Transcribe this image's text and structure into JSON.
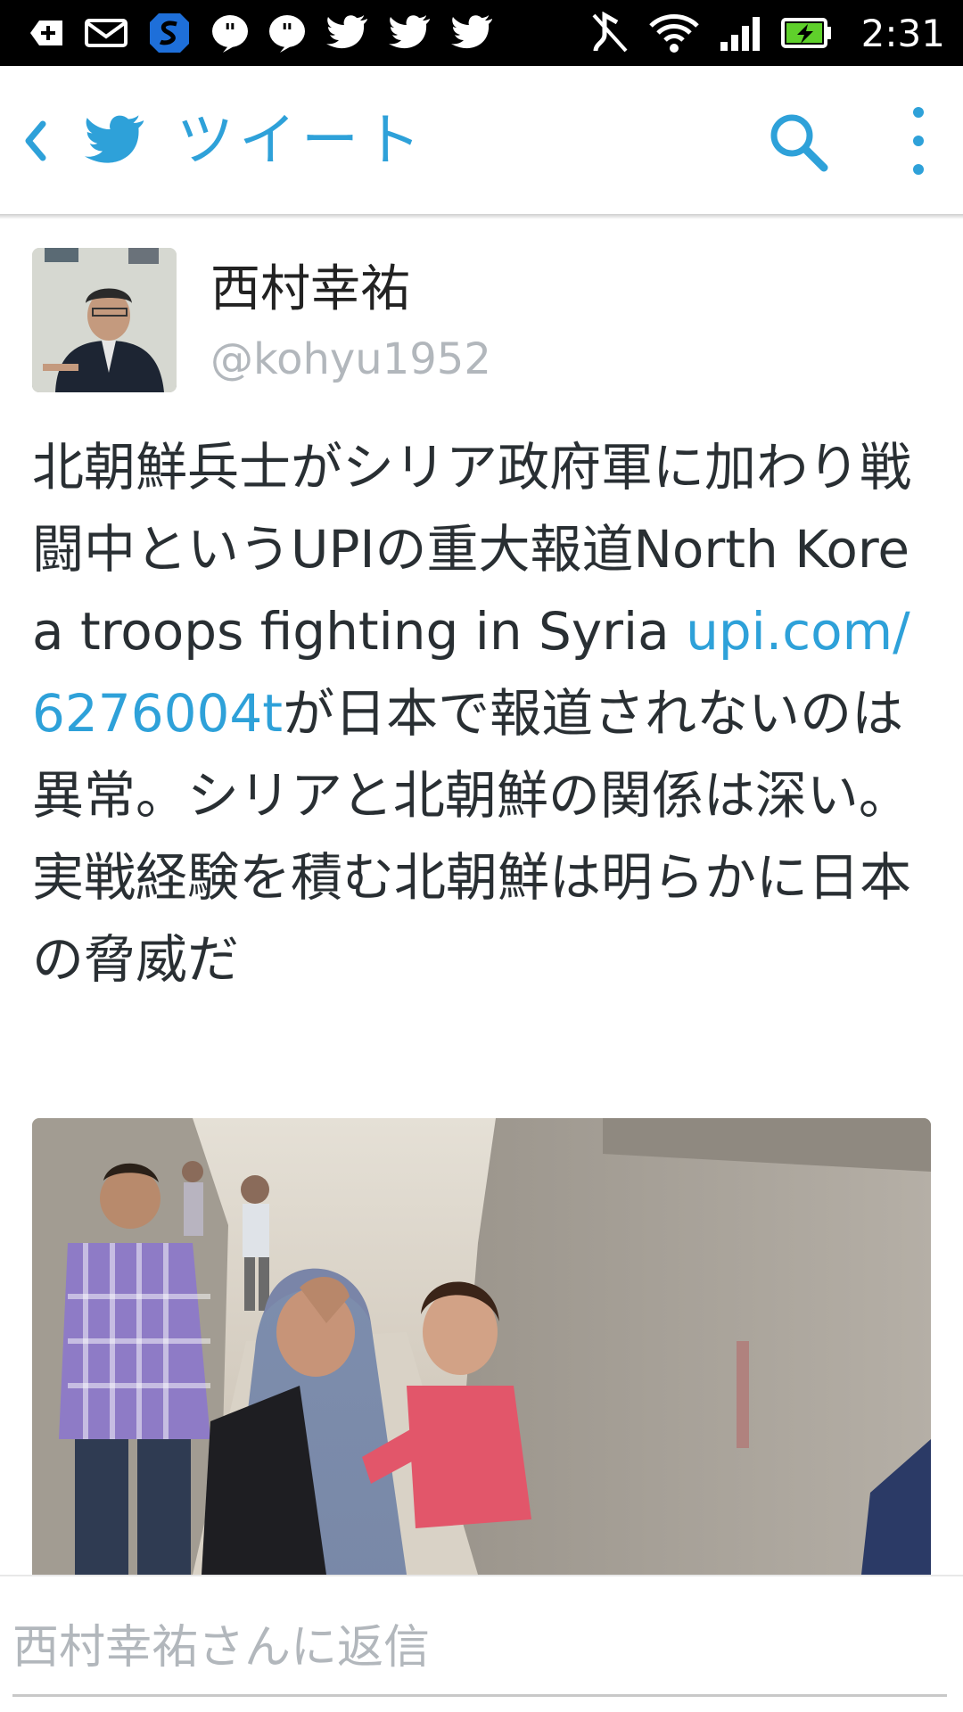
{
  "status_bar": {
    "time": "2:31",
    "left_icons": [
      "add-notification-icon",
      "mail-icon",
      "s-app-icon",
      "quote-icon",
      "quote-icon",
      "twitter-bird-icon",
      "twitter-bird-icon",
      "twitter-bird-icon"
    ],
    "right_icons": [
      "nfc-icon",
      "wifi-icon",
      "signal-icon",
      "battery-charging-icon"
    ]
  },
  "app_bar": {
    "title": "ツイート",
    "back_icon": "chevron-left-icon",
    "logo_icon": "twitter-logo-icon",
    "search_icon": "search-icon",
    "overflow_icon": "overflow-menu-icon"
  },
  "tweet": {
    "author_name": "西村幸祐",
    "author_handle": "@kohyu1952",
    "text_before_link": "北朝鮮兵士がシリア政府軍に加わり戦闘中というUPIの重大報道North Korea troops fighting in Syria ",
    "link": "upi.com/6276004t",
    "text_after_link": "が日本で報道されないのは異常。シリアと北朝鮮の関係は深い。実戦経験を積む北朝鮮は明らかに日本の脅威だ",
    "media_icon": "photo-icon"
  },
  "reply": {
    "placeholder": "西村幸祐さんに返信"
  },
  "colors": {
    "accent": "#2ea1d9",
    "text": "#292f33",
    "secondary_text": "#b2b7bc",
    "status_bar_bg": "#000000",
    "battery_fill": "#5fd02b"
  }
}
